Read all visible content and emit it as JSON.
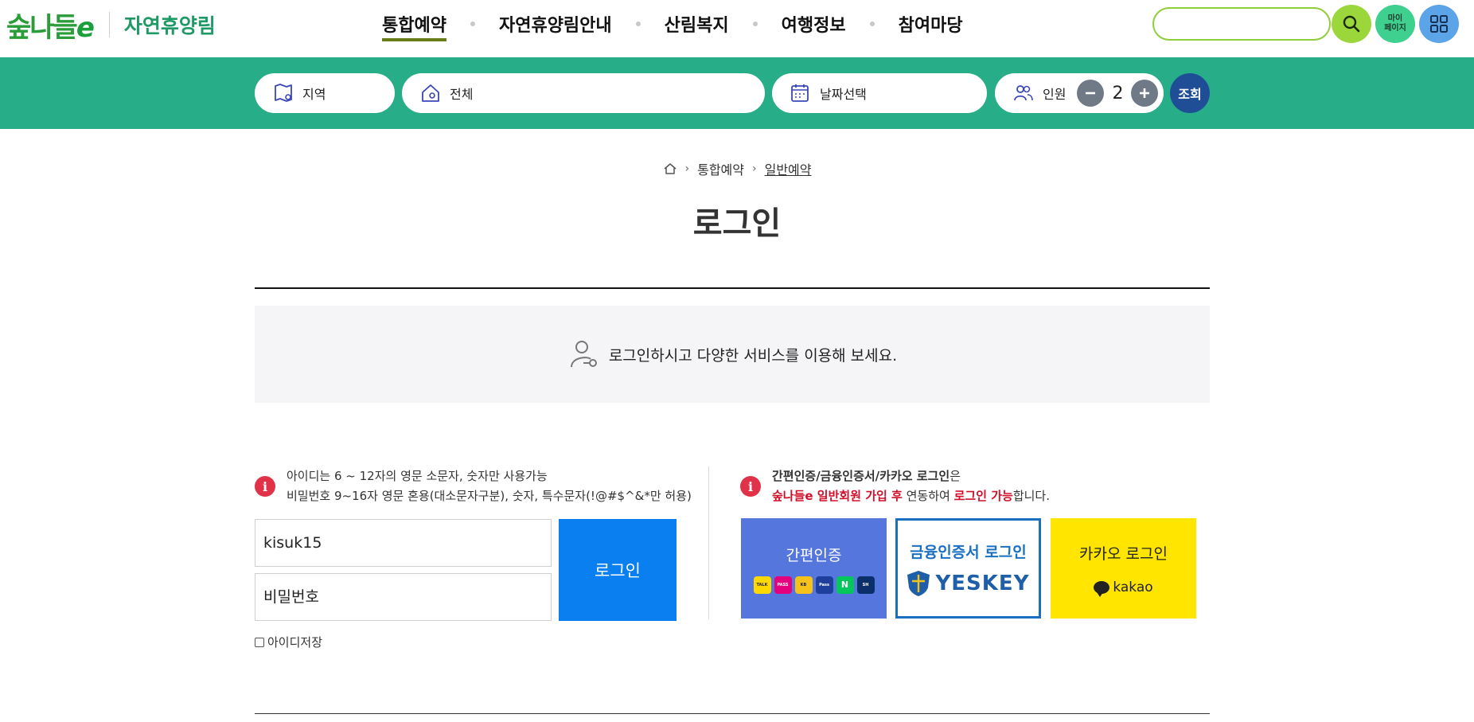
{
  "header": {
    "logo_text": "숲나들",
    "logo_e": "e",
    "site_name": "자연휴양림",
    "nav": [
      {
        "label": "통합예약",
        "active": true
      },
      {
        "label": "자연휴양림안내"
      },
      {
        "label": "산림복지"
      },
      {
        "label": "여행정보"
      },
      {
        "label": "참여마당"
      }
    ],
    "search_value": "",
    "my_page_label_1": "마이",
    "my_page_label_2": "페이지"
  },
  "search_bar": {
    "region_label": "지역",
    "facility_label": "전체",
    "date_label": "날짜선택",
    "people_label": "인원",
    "people_count": "2",
    "query_label": "조회"
  },
  "breadcrumb": {
    "level1": "통합예약",
    "level2": "일반예약"
  },
  "page_title": "로그인",
  "notice_text": "로그인하시고 다양한 서비스를 이용해 보세요.",
  "login": {
    "rule_line1": "아이디는 6 ~ 12자의 영문 소문자, 숫자만 사용가능",
    "rule_line2": "비밀번호 9~16자 영문 혼용(대소문자구분), 숫자, 특수문자(!@#$^&*만 허용)",
    "id_value": "kisuk15",
    "pw_placeholder": "비밀번호",
    "login_button": "로그인",
    "save_id_label": "아이디저장"
  },
  "sns": {
    "info_line1_bold": "간편인증/금융인증서/카카오 로그인",
    "info_line1_rest": "은",
    "info_line2_red1": "숲나들e 일반회원 가입 후",
    "info_line2_mid": " 연동하여 ",
    "info_line2_red2": "로그인 가능",
    "info_line2_end": "합니다.",
    "simple_auth_label": "간편인증",
    "fin_cert_label": "금융인증서 로그인",
    "yeskey_label": "YESKEY",
    "kakao_label": "카카오 로그인",
    "kakao_word": "kakao"
  },
  "colors": {
    "bar_green": "#27ad88",
    "login_blue": "#0a7ff0",
    "alert_red": "#e0334a",
    "kakao_yellow": "#ffe500"
  }
}
